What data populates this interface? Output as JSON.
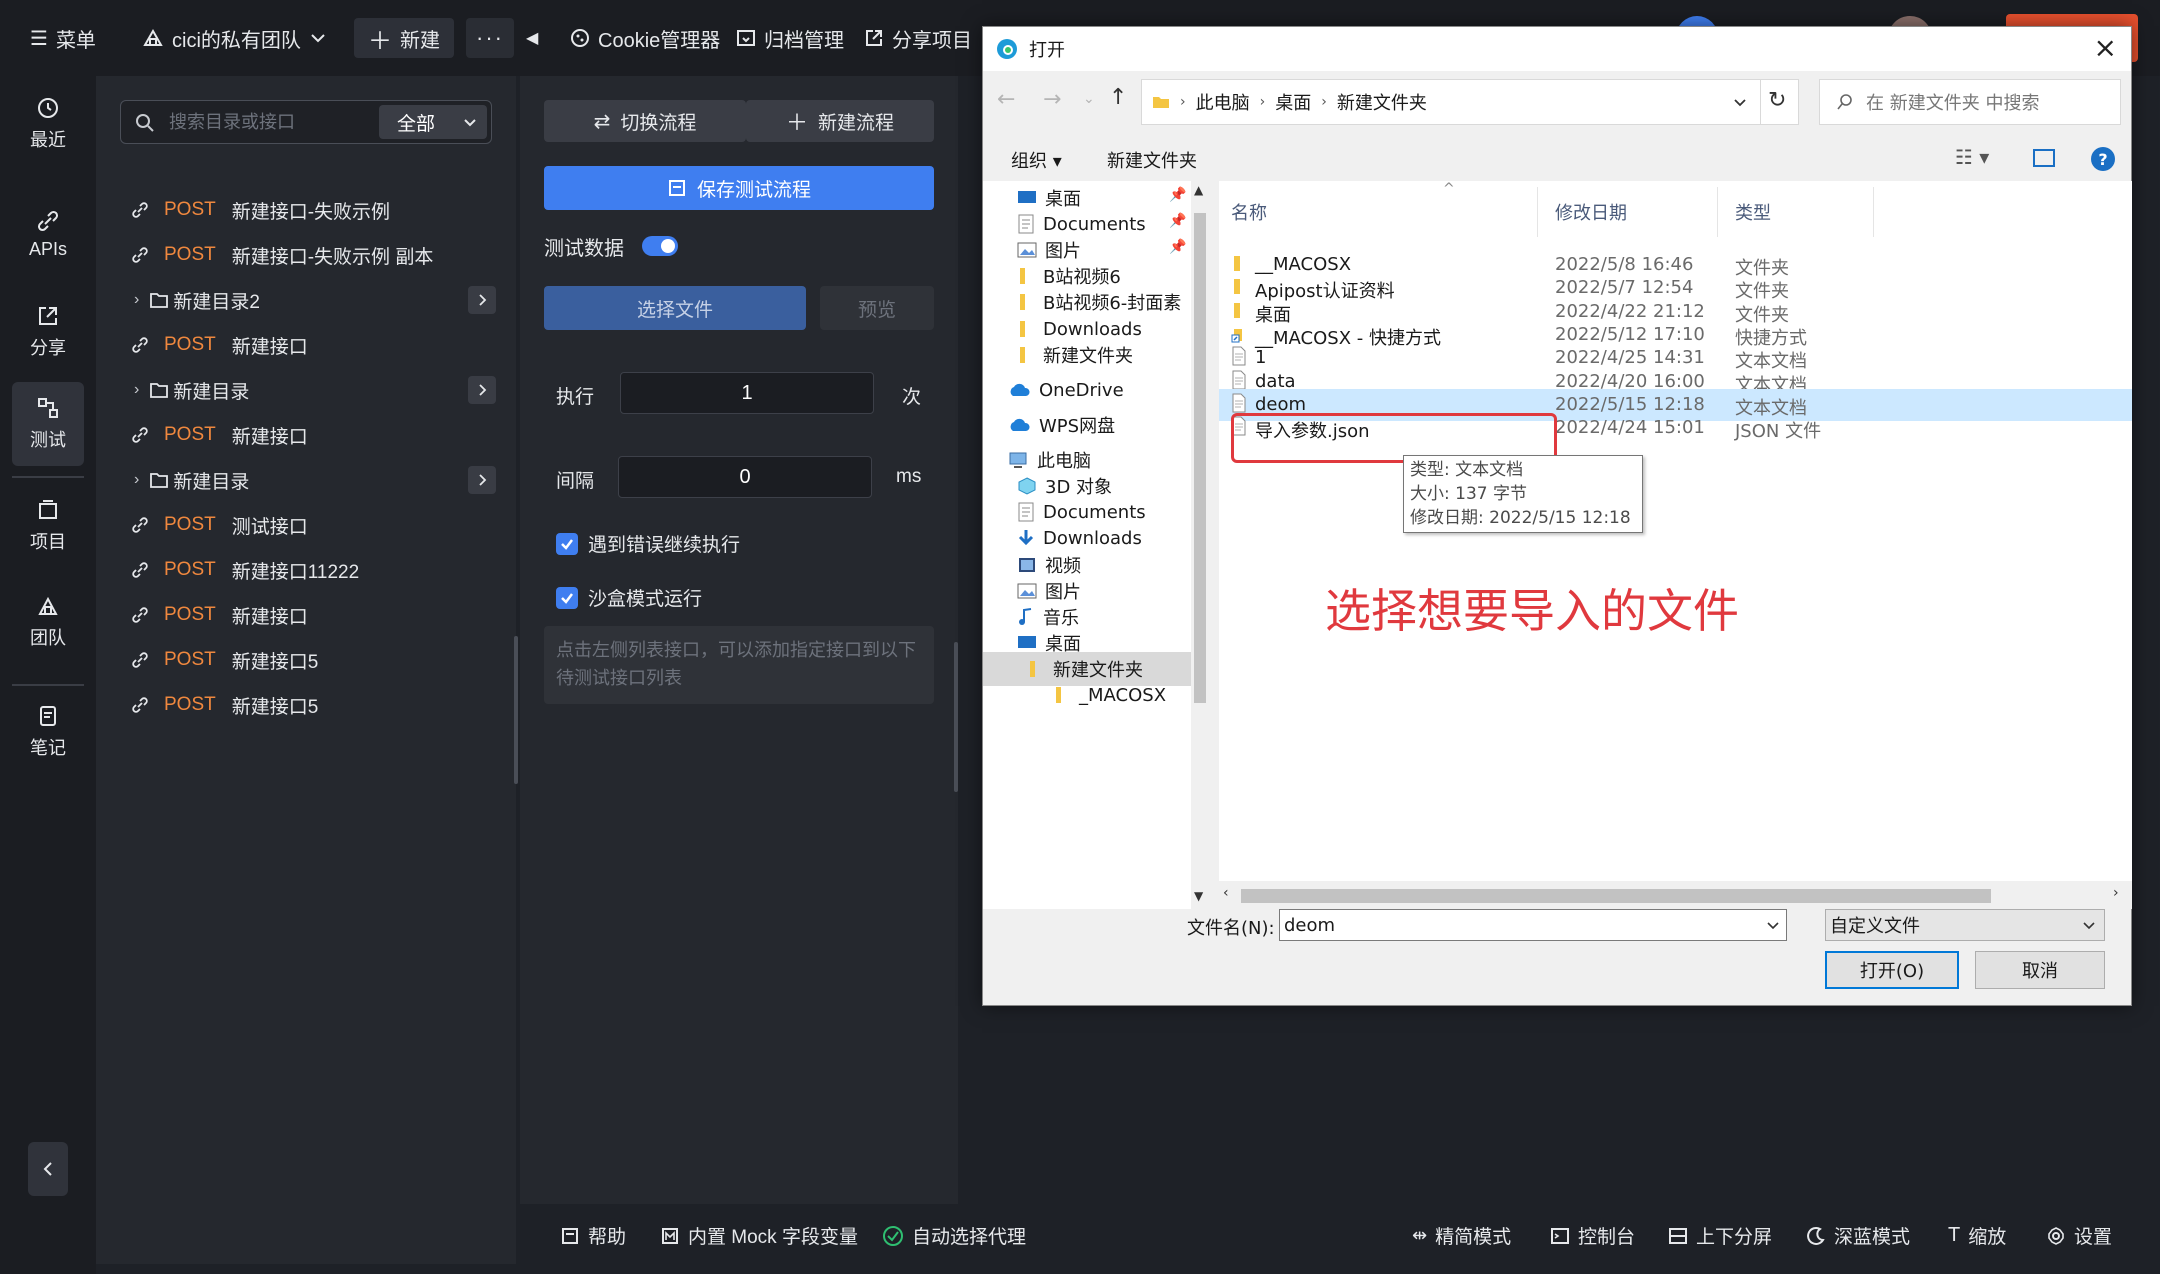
{
  "topbar": {
    "menu": "菜单",
    "team": "cici的私有团队",
    "new": "新建",
    "more": "···",
    "cookie": "Cookie管理器",
    "archive": "归档管理",
    "share_project": "分享项目"
  },
  "leftnav": {
    "items": [
      "最近",
      "APIs",
      "分享",
      "测试",
      "项目",
      "团队",
      "笔记"
    ]
  },
  "tree": {
    "search_placeholder": "搜索目录或接口",
    "filter": "全部",
    "rows": [
      {
        "method": "POST",
        "name": "新建接口-失败示例"
      },
      {
        "method": "POST",
        "name": "新建接口-失败示例 副本"
      },
      {
        "folder": "新建目录2"
      },
      {
        "method": "POST",
        "name": "新建接口"
      },
      {
        "folder": "新建目录"
      },
      {
        "method": "POST",
        "name": "新建接口"
      },
      {
        "folder": "新建目录"
      },
      {
        "method": "POST",
        "name": "测试接口"
      },
      {
        "method": "POST",
        "name": "新建接口11222"
      },
      {
        "method": "POST",
        "name": "新建接口"
      },
      {
        "method": "POST",
        "name": "新建接口5"
      },
      {
        "method": "POST",
        "name": "新建接口5"
      }
    ]
  },
  "test": {
    "switch_flow": "切换流程",
    "new_flow": "新建流程",
    "save_flow": "保存测试流程",
    "test_data": "测试数据",
    "choose_file": "选择文件",
    "preview": "预览",
    "exec_label": "执行",
    "exec_value": "1",
    "exec_unit": "次",
    "interval_label": "间隔",
    "interval_value": "0",
    "interval_unit": "ms",
    "continue_on_error": "遇到错误继续执行",
    "sandbox": "沙盒模式运行",
    "hint": "点击左侧列表接口，可以添加指定接口到以下待测试接口列表"
  },
  "bottombar": {
    "help": "帮助",
    "mock": "内置 Mock 字段变量",
    "proxy": "自动选择代理",
    "simple": "精简模式",
    "console": "控制台",
    "split": "上下分屏",
    "dark": "深蓝模式",
    "zoom": "缩放",
    "settings": "设置"
  },
  "dialog": {
    "title": "打开",
    "breadcrumb": [
      "此电脑",
      "桌面",
      "新建文件夹"
    ],
    "search_placeholder": "在 新建文件夹 中搜索",
    "organize": "组织",
    "new_folder": "新建文件夹",
    "columns": {
      "name": "名称",
      "date": "修改日期",
      "type": "类型"
    },
    "nav": [
      {
        "label": "桌面",
        "icon": "desktop"
      },
      {
        "label": "Documents",
        "icon": "docs"
      },
      {
        "label": "图片",
        "icon": "pictures"
      },
      {
        "label": "B站视频6",
        "icon": "folder"
      },
      {
        "label": "B站视频6-封面素",
        "icon": "folder"
      },
      {
        "label": "Downloads",
        "icon": "folder"
      },
      {
        "label": "新建文件夹",
        "icon": "folder"
      },
      {
        "label": "OneDrive",
        "icon": "cloud"
      },
      {
        "label": "WPS网盘",
        "icon": "cloud"
      },
      {
        "label": "此电脑",
        "icon": "pc"
      },
      {
        "label": "3D 对象",
        "icon": "3d"
      },
      {
        "label": "Documents",
        "icon": "docs"
      },
      {
        "label": "Downloads",
        "icon": "download"
      },
      {
        "label": "视频",
        "icon": "video"
      },
      {
        "label": "图片",
        "icon": "pictures"
      },
      {
        "label": "音乐",
        "icon": "music"
      },
      {
        "label": "桌面",
        "icon": "desktop"
      },
      {
        "label": "新建文件夹",
        "icon": "folder"
      },
      {
        "label": "_MACOSX",
        "icon": "folder"
      }
    ],
    "files": [
      {
        "name": "__MACOSX",
        "date": "2022/5/8 16:46",
        "type": "文件夹",
        "icon": "folder"
      },
      {
        "name": "Apipost认证资料",
        "date": "2022/5/7 12:54",
        "type": "文件夹",
        "icon": "folder"
      },
      {
        "name": "桌面",
        "date": "2022/4/22 21:12",
        "type": "文件夹",
        "icon": "folder"
      },
      {
        "name": "__MACOSX - 快捷方式",
        "date": "2022/5/12 17:10",
        "type": "快捷方式",
        "icon": "shortcut"
      },
      {
        "name": "1",
        "date": "2022/4/25 14:31",
        "type": "文本文档",
        "icon": "text"
      },
      {
        "name": "data",
        "date": "2022/4/20 16:00",
        "type": "文本文档",
        "icon": "text"
      },
      {
        "name": "deom",
        "date": "2022/5/15 12:18",
        "type": "文本文档",
        "icon": "text",
        "selected": true
      },
      {
        "name": "导入参数.json",
        "date": "2022/4/24 15:01",
        "type": "JSON 文件",
        "icon": "text"
      }
    ],
    "tooltip": [
      "类型: 文本文档",
      "大小: 137 字节",
      "修改日期: 2022/5/15 12:18"
    ],
    "annotation": "选择想要导入的文件",
    "filename_label": "文件名(N):",
    "filename_value": "deom",
    "filetype": "自定义文件",
    "open_button": "打开(O)",
    "cancel_button": "取消"
  },
  "colors": {
    "accent": "#3f7ef0",
    "method_post": "#f0883e",
    "annotation_red": "#e0393e",
    "selection": "#cce8ff"
  }
}
